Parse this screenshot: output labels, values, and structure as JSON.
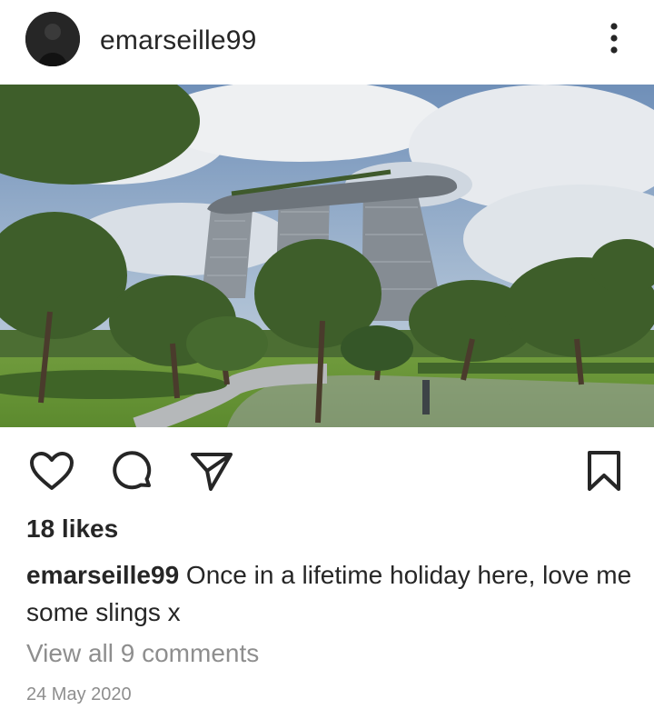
{
  "post": {
    "username": "emarseille99",
    "likes_text": "18 likes",
    "caption_user": "emarseille99",
    "caption_text": " Once in a lifetime holiday here, love me some slings x",
    "view_comments": "View all 9 comments",
    "date": "24 May 2020"
  },
  "icons": {
    "more": "more-options-icon",
    "like": "heart-icon",
    "comment": "comment-icon",
    "share": "send-icon",
    "save": "bookmark-icon"
  },
  "colors": {
    "text": "#262626",
    "muted": "#8e8e8e",
    "background": "#ffffff"
  }
}
